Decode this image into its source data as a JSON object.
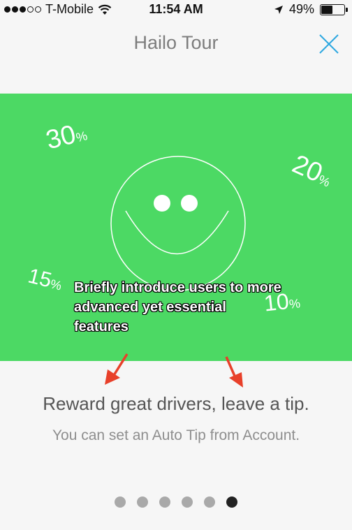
{
  "status_bar": {
    "carrier": "T-Mobile",
    "time": "11:54 AM",
    "battery": "49%",
    "battery_level": 0.49,
    "signal_bars_filled": 3,
    "signal_bars_total": 5
  },
  "header": {
    "title": "Hailo Tour",
    "close_icon": "close-icon",
    "accent_color": "#2ea8e0"
  },
  "hero": {
    "background_color": "#4cd964",
    "percentages": [
      {
        "value": "30",
        "unit": "%"
      },
      {
        "value": "20",
        "unit": "%"
      },
      {
        "value": "15",
        "unit": "%"
      },
      {
        "value": "10",
        "unit": "%"
      }
    ],
    "annotation": "Briefly introduce users to more advanced yet essential features"
  },
  "content": {
    "headline": "Reward great drivers, leave a tip.",
    "subline": "You can set an Auto Tip from Account."
  },
  "pager": {
    "total": 6,
    "active_index": 5
  }
}
